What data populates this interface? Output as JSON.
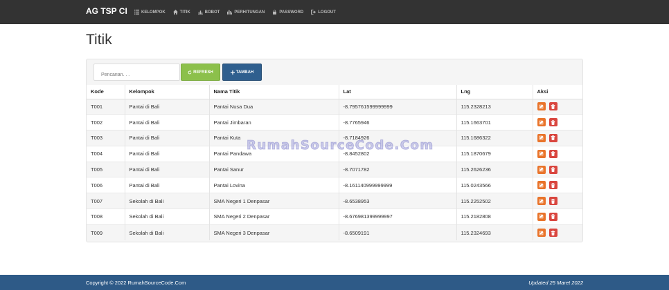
{
  "brand": "AG TSP CI",
  "nav": [
    {
      "label": "KELOMPOK",
      "icon": "list-icon"
    },
    {
      "label": "TITIK",
      "icon": "home-icon"
    },
    {
      "label": "BOBOT",
      "icon": "bar-chart-icon"
    },
    {
      "label": "PERHITUNGAN",
      "icon": "stats-icon"
    },
    {
      "label": "PASSWORD",
      "icon": "lock-icon"
    },
    {
      "label": "LOGOUT",
      "icon": "logout-icon"
    }
  ],
  "page_title": "Titik",
  "search": {
    "placeholder": "Pencarian. . ."
  },
  "buttons": {
    "refresh": "REFRESH",
    "add": "TAMBAH"
  },
  "table": {
    "headers": [
      "Kode",
      "Kelompok",
      "Nama Titik",
      "Lat",
      "Lng",
      "Aksi"
    ],
    "rows": [
      [
        "T001",
        "Pantai di Bali",
        "Pantai Nusa Dua",
        "-8.795761599999999",
        "115.2328213"
      ],
      [
        "T002",
        "Pantai di Bali",
        "Pantai Jimbaran",
        "-8.7765946",
        "115.1663701"
      ],
      [
        "T003",
        "Pantai di Bali",
        "Pantai Kuta",
        "-8.7184926",
        "115.1686322"
      ],
      [
        "T004",
        "Pantai di Bali",
        "Pantai Pandawa",
        "-8.8452802",
        "115.1870679"
      ],
      [
        "T005",
        "Pantai di Bali",
        "Pantai Sanur",
        "-8.7071782",
        "115.2626236"
      ],
      [
        "T006",
        "Pantai di Bali",
        "Pantai Lovina",
        "-8.161140999999999",
        "115.0243566"
      ],
      [
        "T007",
        "Sekolah di Bali",
        "SMA Negeri 1 Denpasar",
        "-8.6538953",
        "115.2252502"
      ],
      [
        "T008",
        "Sekolah di Bali",
        "SMA Negeri 2 Denpasar",
        "-8.676981399999997",
        "115.2182808"
      ],
      [
        "T009",
        "Sekolah di Bali",
        "SMA Negeri 3 Denpasar",
        "-8.6509191",
        "115.2324693"
      ]
    ]
  },
  "watermark": "RumahSourceCode.Com",
  "footer": {
    "left": "Copyright © 2022 RumahSourceCode.Com",
    "right": "Updated 25 Maret 2022"
  },
  "colors": {
    "navbar": "#333333",
    "footer": "#2e5a87",
    "refresh": "#8cc04b",
    "add": "#2f5f8e",
    "edit": "#e9742b",
    "delete": "#d9463f"
  }
}
